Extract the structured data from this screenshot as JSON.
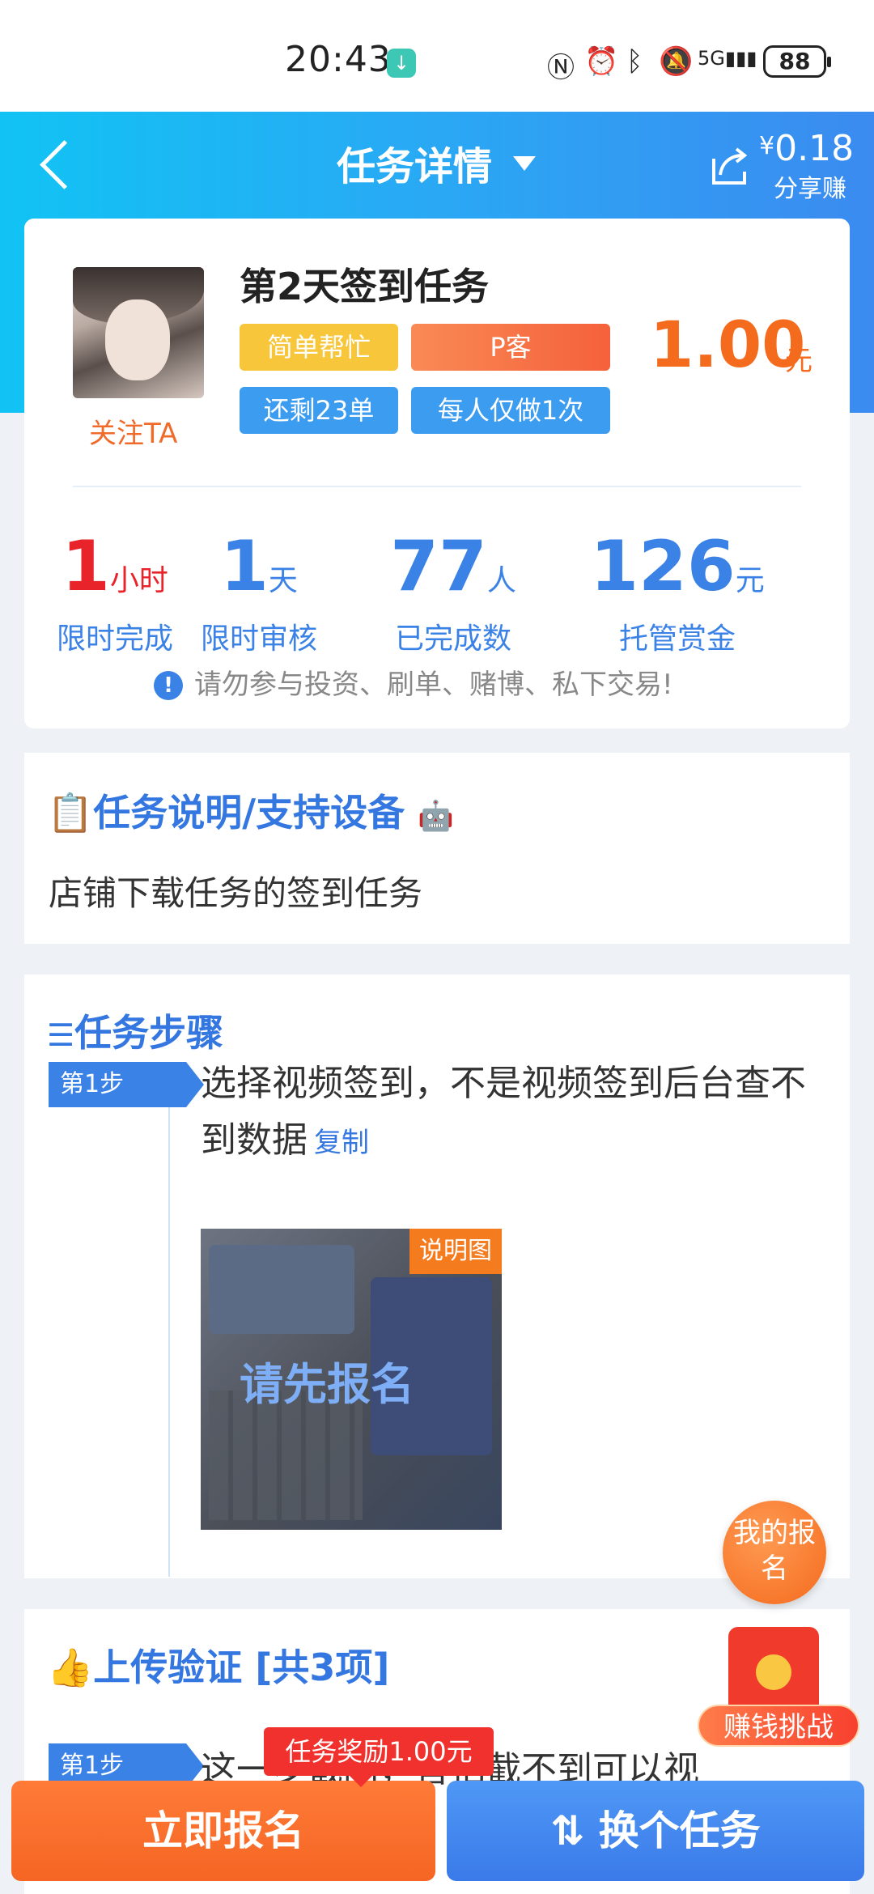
{
  "status_bar": {
    "time": "20:43",
    "battery": "88"
  },
  "header": {
    "title": "任务详情",
    "share_amount": "0.18",
    "share_currency": "¥",
    "share_label": "分享赚"
  },
  "task": {
    "follow_label": "关注TA",
    "title": "第2天签到任务",
    "tags": [
      "简单帮忙",
      "P客",
      "还剩23单",
      "每人仅做1次"
    ],
    "price": "1.00",
    "price_unit": "元",
    "stats": [
      {
        "value": "1",
        "unit": "小时",
        "label": "限时完成",
        "color": "#e8232a"
      },
      {
        "value": "1",
        "unit": "天",
        "label": "限时审核",
        "color": "#3b82e6"
      },
      {
        "value": "77",
        "unit": "人",
        "label": "已完成数",
        "color": "#3b82e6"
      },
      {
        "value": "126",
        "unit": "元",
        "label": "托管赏金",
        "color": "#3b82e6"
      }
    ],
    "warning": "请勿参与投资、刷单、赌博、私下交易!"
  },
  "description": {
    "title": "任务说明/支持设备",
    "text": "店铺下载任务的签到任务"
  },
  "steps": {
    "title": "任务步骤",
    "step1_badge": "第1步",
    "step1_text": "选择视频签到，不是视频签到后台查不到数据",
    "copy_label": "复制",
    "image_label": "说明图",
    "image_overlay": "请先报名"
  },
  "verify": {
    "title": "上传验证 [共3项]",
    "step1_badge": "第1步",
    "step1_text": "这一步截图，害怕截不到可以视"
  },
  "floats": {
    "my_signup": "我的报名",
    "challenge": "赚钱挑战"
  },
  "bottom": {
    "reward_tip": "任务奖励1.00元",
    "signup": "立即报名",
    "switch": "换个任务"
  },
  "colors": {
    "brand_blue": "#3b82e6",
    "orange": "#f46b1e",
    "red": "#e8232a"
  }
}
